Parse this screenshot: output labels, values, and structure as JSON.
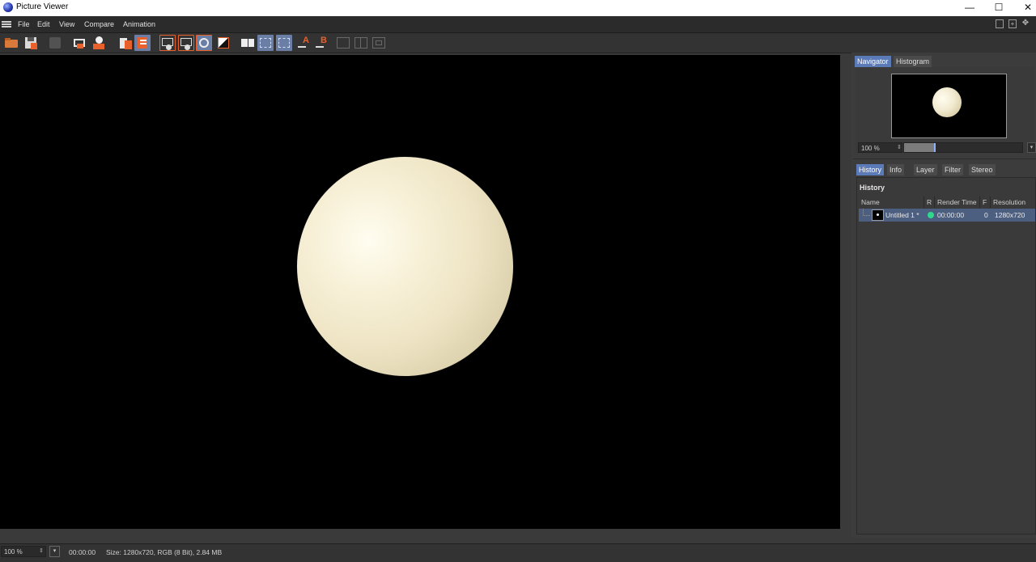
{
  "window": {
    "title": "Picture Viewer",
    "app_icon": "cinema4d-icon",
    "minimize": "—",
    "maximize": "☐",
    "close": "✕"
  },
  "menu": {
    "items": [
      "File",
      "Edit",
      "View",
      "Compare",
      "Animation"
    ]
  },
  "toolbar": {
    "buttons": [
      "open-icon",
      "save-icon",
      "stop-render-icon",
      "render-region-icon",
      "render-to-viewer-icon",
      "copy-icon",
      "paste-icon",
      "show-a-icon",
      "show-b-icon",
      "show-ab-icon",
      "show-diff-icon",
      "ab-compare-icon",
      "split-horizontal-icon",
      "split-vertical-icon",
      "set-a-icon",
      "set-b-icon",
      "layout-1-icon",
      "layout-2-icon",
      "layout-3-icon"
    ],
    "accent": "#e8602c",
    "selected": "#6b7fa6"
  },
  "viewer": {
    "background": "#000000",
    "sphere_color": "#f3ead0"
  },
  "navigator": {
    "tabs": [
      "Navigator",
      "Histogram"
    ],
    "active_tab": "Navigator",
    "zoom_value": "100 %",
    "zoom_slider_fraction": 0.25
  },
  "info_tabs": {
    "tabs": [
      "History",
      "Info",
      "Layer",
      "Filter",
      "Stereo"
    ],
    "active_tab": "History"
  },
  "history": {
    "title": "History",
    "columns": [
      "Name",
      "R",
      "Render Time",
      "F",
      "Resolution"
    ],
    "rows": [
      {
        "name": "Untitled 1 *",
        "render_status": "complete",
        "render_time": "00:00:00",
        "frame": "0",
        "resolution": "1280x720"
      }
    ]
  },
  "statusbar": {
    "zoom": "100 %",
    "time": "00:00:00",
    "info": "Size: 1280x720, RGB (8 Bit), 2.84 MB"
  }
}
